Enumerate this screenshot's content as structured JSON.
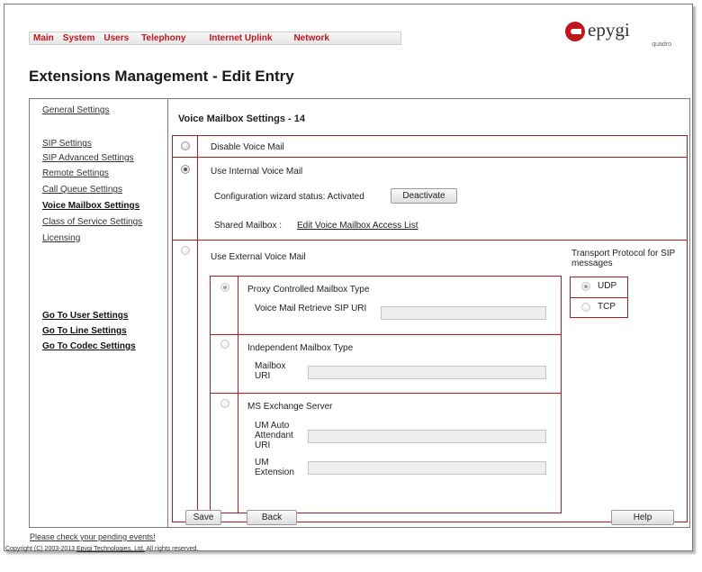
{
  "nav": {
    "items": [
      "Main",
      "System",
      "Users",
      "Telephony",
      "Internet Uplink",
      "Network"
    ]
  },
  "logo": {
    "brand": "epygi",
    "sub": "quadro"
  },
  "page_title": "Extensions Management - Edit Entry",
  "sidebar": {
    "links": [
      "General Settings",
      "SIP Settings",
      "SIP Advanced Settings",
      "Remote Settings",
      "Call Queue Settings",
      "Voice Mailbox Settings",
      "Class of Service Settings",
      "Licensing"
    ],
    "goto": [
      "Go To User Settings",
      "Go To Line Settings",
      "Go To Codec Settings"
    ]
  },
  "section_title": "Voice Mailbox Settings - 14",
  "options": {
    "disable": "Disable Voice Mail",
    "internal": "Use Internal Voice Mail",
    "wizard_label": "Configuration wizard status: Activated",
    "deactivate_button": "Deactivate",
    "shared_label": "Shared Mailbox :",
    "shared_link": "Edit Voice Mailbox Access List",
    "external": "Use External Voice Mail"
  },
  "transport": {
    "label": "Transport Protocol for SIP messages",
    "udp": "UDP",
    "tcp": "TCP"
  },
  "mailbox_types": {
    "proxy": "Proxy Controlled Mailbox Type",
    "proxy_field": "Voice Mail Retrieve SIP URI",
    "independent": "Independent Mailbox Type",
    "independent_field": "Mailbox URI",
    "exchange": "MS Exchange Server",
    "um_auto_field": "UM Auto Attendant URI",
    "um_ext_field": "UM Extension"
  },
  "buttons": {
    "save": "Save",
    "back": "Back",
    "help": "Help"
  },
  "footer": {
    "pending": "Please check your pending events!",
    "copyright_pre": "Copyright (C) 2003-2013",
    "company": "Epygi Technologies, Ltd.",
    "copyright_post": "All rights reserved."
  },
  "colors": {
    "accent": "#c0161c",
    "border_red": "#b31b20"
  }
}
